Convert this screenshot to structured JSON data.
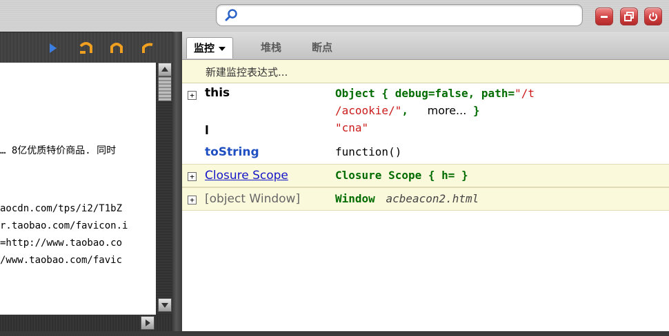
{
  "search": {
    "value": "",
    "placeholder": ""
  },
  "colors": {
    "window_button": "#d04040",
    "object_green": "#006c00",
    "string_red": "#cc1a1a",
    "link_blue": "#1515c8"
  },
  "toolbar": {
    "icons": [
      "play-arrow-icon",
      "step-over-icon",
      "step-into-icon",
      "step-out-icon"
    ]
  },
  "source": {
    "lines": [
      "… 8亿优质特价商品. 同时",
      "aocdn.com/tps/i2/T1bZ",
      "r.taobao.com/favicon.i",
      "=http://www.taobao.co",
      "/www.taobao.com/favic"
    ]
  },
  "tabs": [
    {
      "label": "监控"
    },
    {
      "label": "堆栈"
    },
    {
      "label": "断点"
    }
  ],
  "watch": {
    "new_expression": "新建监控表达式...",
    "rows": {
      "this": {
        "expander": "+",
        "name": "this",
        "value_line1": "Object {  debug=false,   path=",
        "value_line1_str": "\"/t",
        "value_line2_str": "/acookie/\"",
        "value_line2_sep": ",",
        "value_more": "more...",
        "value_close": "}"
      },
      "l": {
        "name": "l",
        "value": "\"cna\""
      },
      "tostring": {
        "name": "toString",
        "value": "function()"
      },
      "closure": {
        "expander": "+",
        "name": "Closure Scope",
        "value": "Closure Scope {  h= }"
      },
      "window": {
        "expander": "+",
        "name": "[object Window]",
        "value_type": "Window",
        "value_file": "acbeacon2.html"
      }
    }
  }
}
